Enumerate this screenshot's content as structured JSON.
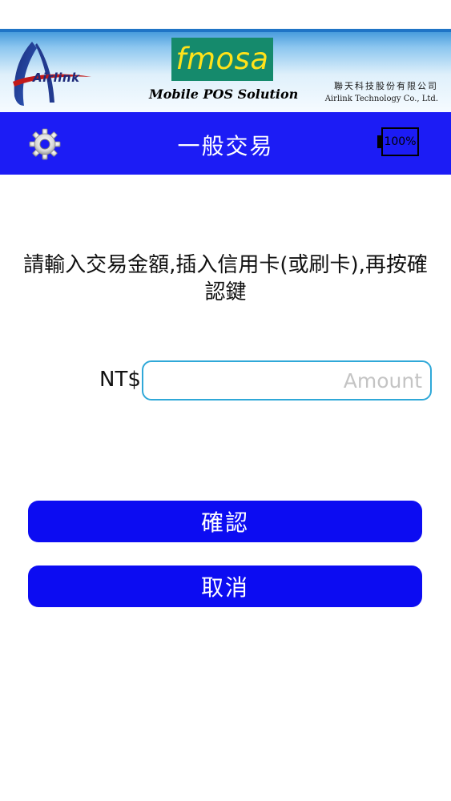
{
  "header": {
    "logo_text": "Airlink",
    "brand": "fmosa",
    "tagline": "Mobile POS Solution",
    "company_cn": "聯天科技股份有限公司",
    "company_en": "Airlink Technology Co., Ltd.",
    "colors": {
      "brand_box": "#158a6c",
      "brand_text": "#ffe21a"
    }
  },
  "navbar": {
    "title": "一般交易",
    "settings_icon": "gear-icon",
    "battery": {
      "level_percent": 100,
      "label": "100%"
    },
    "color": "#1c1cf5"
  },
  "main": {
    "instruction": "請輸入交易金額,插入信用卡(或刷卡),再按確認鍵",
    "currency_label": "NT$",
    "amount_input": {
      "value": "",
      "placeholder": "Amount"
    },
    "confirm_label": "確認",
    "cancel_label": "取消",
    "button_color": "#0c0cf2"
  }
}
